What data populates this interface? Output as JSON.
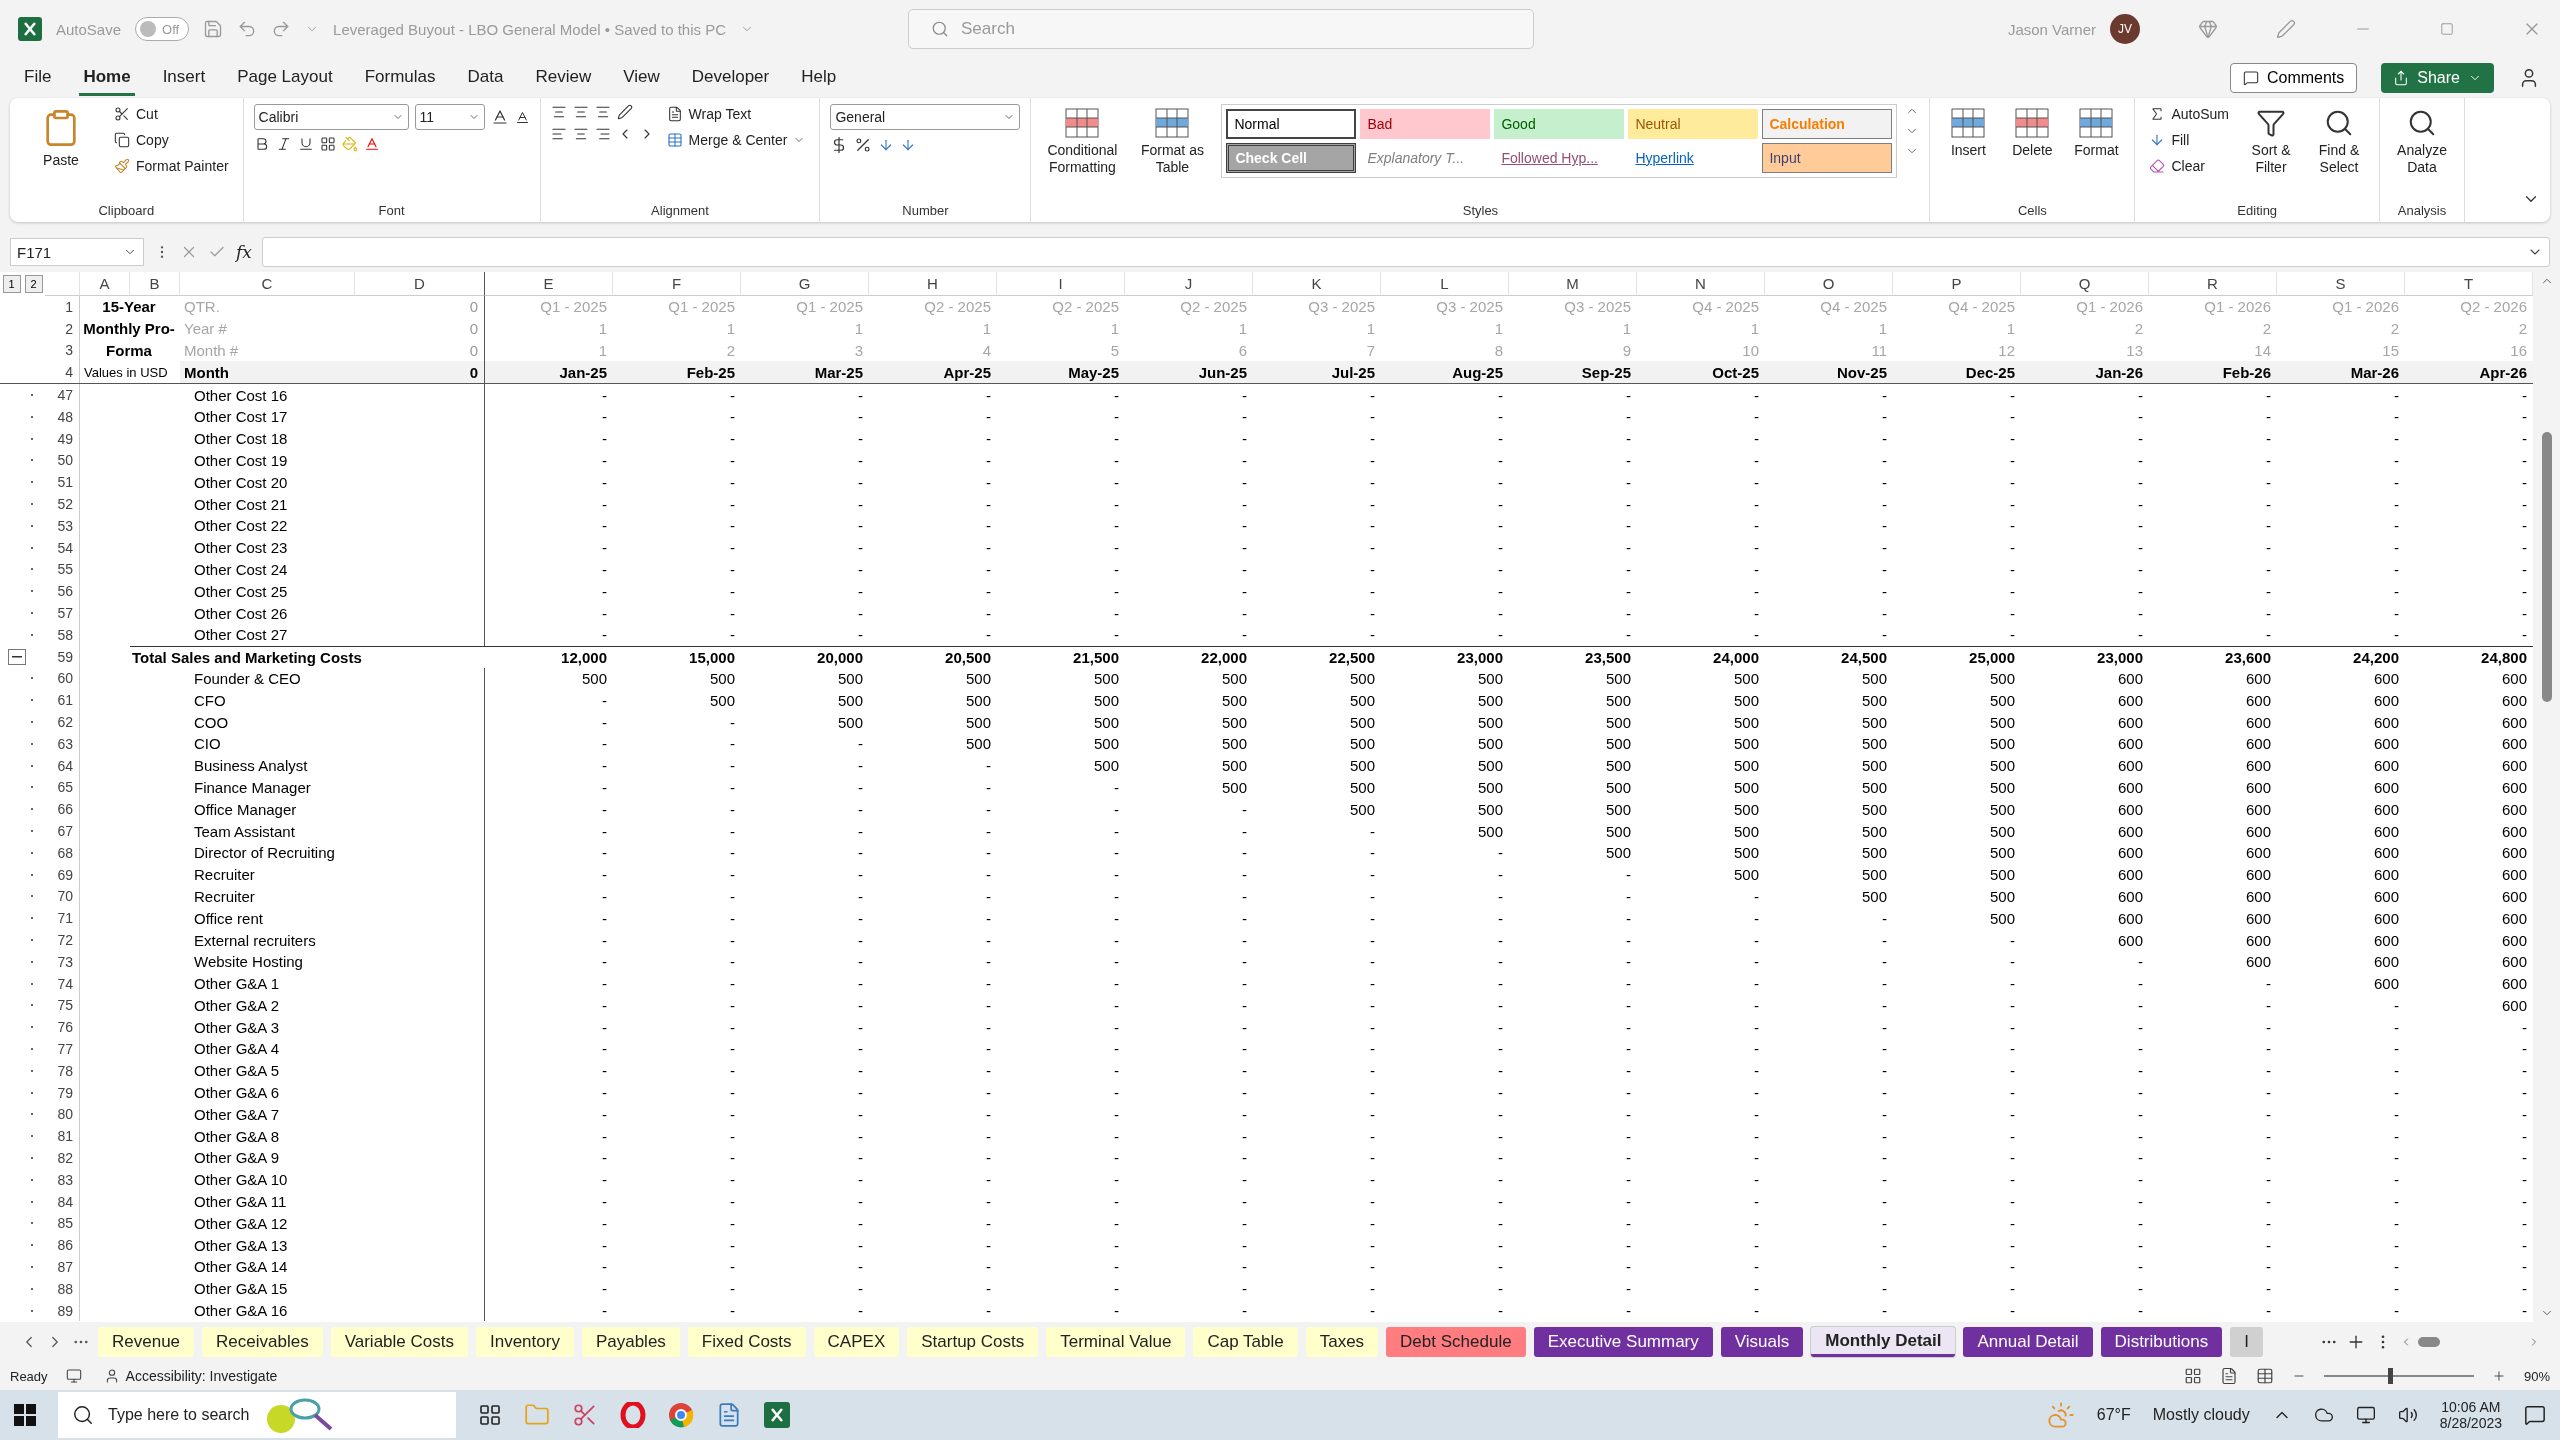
{
  "title_bar": {
    "autosave": {
      "label": "AutoSave",
      "state": "Off",
      "on": false
    },
    "document_title": "Leveraged Buyout - LBO General Model • Saved to this PC",
    "search": {
      "placeholder": "Search"
    },
    "user": {
      "name": "Jason Varner",
      "initials": "JV"
    }
  },
  "menu_tabs": [
    {
      "label": "File",
      "selected": false
    },
    {
      "label": "Home",
      "selected": true
    },
    {
      "label": "Insert",
      "selected": false
    },
    {
      "label": "Page Layout",
      "selected": false
    },
    {
      "label": "Formulas",
      "selected": false
    },
    {
      "label": "Data",
      "selected": false
    },
    {
      "label": "Review",
      "selected": false
    },
    {
      "label": "View",
      "selected": false
    },
    {
      "label": "Developer",
      "selected": false
    },
    {
      "label": "Help",
      "selected": false
    }
  ],
  "comments_button": "Comments",
  "share_button": "Share",
  "ribbon": {
    "clipboard": {
      "paste": "Paste",
      "cut": "Cut",
      "copy": "Copy",
      "format_painter": "Format Painter",
      "label": "Clipboard"
    },
    "font": {
      "name": "Calibri",
      "size": "11",
      "label": "Font"
    },
    "alignment": {
      "wrap_text": "Wrap Text",
      "merge_center": "Merge & Center",
      "label": "Alignment"
    },
    "number": {
      "format": "General",
      "label": "Number"
    },
    "styles": {
      "conditional": "Conditional Formatting",
      "format_table": "Format as Table",
      "label": "Styles",
      "cell_styles": [
        {
          "label": "Normal",
          "kind": "normal"
        },
        {
          "label": "Bad",
          "kind": "bad"
        },
        {
          "label": "Good",
          "kind": "good"
        },
        {
          "label": "Neutral",
          "kind": "neutral"
        },
        {
          "label": "Calculation",
          "kind": "calculation"
        },
        {
          "label": "Check Cell",
          "kind": "check"
        },
        {
          "label": "Explanatory T...",
          "kind": "explanatory"
        },
        {
          "label": "Followed Hyp...",
          "kind": "followed"
        },
        {
          "label": "Hyperlink",
          "kind": "hyperlink"
        },
        {
          "label": "Input",
          "kind": "input"
        }
      ]
    },
    "cells": {
      "insert": "Insert",
      "delete": "Delete",
      "format": "Format",
      "label": "Cells"
    },
    "editing": {
      "autosum": "AutoSum",
      "fill": "Fill",
      "clear": "Clear",
      "sort_filter": "Sort & Filter",
      "find_select": "Find & Select",
      "label": "Editing"
    },
    "analysis": {
      "analyze": "Analyze Data",
      "label": "Analysis"
    }
  },
  "formula_bar": {
    "name_box": "F171",
    "function_label": "fx"
  },
  "outline_levels": [
    "1",
    "2"
  ],
  "sheet": {
    "columns": [
      "A",
      "B",
      "C",
      "D",
      "E",
      "F",
      "G",
      "H",
      "I",
      "J",
      "K",
      "L",
      "M",
      "N",
      "O",
      "P",
      "Q",
      "R",
      "S",
      "T"
    ],
    "header_rows": [
      {
        "num": "1",
        "kind": "param",
        "title": "15-Year",
        "label": "QTR.",
        "d": "0",
        "values": [
          "Q1 - 2025",
          "Q1 - 2025",
          "Q1 - 2025",
          "Q2 - 2025",
          "Q2 - 2025",
          "Q2 - 2025",
          "Q3 - 2025",
          "Q3 - 2025",
          "Q3 - 2025",
          "Q4 - 2025",
          "Q4 - 2025",
          "Q4 - 2025",
          "Q1 - 2026",
          "Q1 - 2026",
          "Q1 - 2026",
          "Q2 - 2026"
        ]
      },
      {
        "num": "2",
        "kind": "param",
        "title": "Monthly Pro-",
        "label": "Year #",
        "d": "0",
        "values": [
          "1",
          "1",
          "1",
          "1",
          "1",
          "1",
          "1",
          "1",
          "1",
          "1",
          "1",
          "1",
          "2",
          "2",
          "2",
          "2"
        ]
      },
      {
        "num": "3",
        "kind": "param",
        "title": "Forma",
        "label": "Month #",
        "d": "0",
        "values": [
          "1",
          "2",
          "3",
          "4",
          "5",
          "6",
          "7",
          "8",
          "9",
          "10",
          "11",
          "12",
          "13",
          "14",
          "15",
          "16"
        ]
      },
      {
        "num": "4",
        "kind": "month",
        "title": "Values in USD",
        "label": "Month",
        "d": "0",
        "values": [
          "Jan-25",
          "Feb-25",
          "Mar-25",
          "Apr-25",
          "May-25",
          "Jun-25",
          "Jul-25",
          "Aug-25",
          "Sep-25",
          "Oct-25",
          "Nov-25",
          "Dec-25",
          "Jan-26",
          "Feb-26",
          "Mar-26",
          "Apr-26"
        ]
      }
    ],
    "rows": [
      {
        "num": "47",
        "kind": "item",
        "label": "Other Cost 16",
        "values": [
          "-",
          "-",
          "-",
          "-",
          "-",
          "-",
          "-",
          "-",
          "-",
          "-",
          "-",
          "-",
          "-",
          "-",
          "-",
          "-"
        ]
      },
      {
        "num": "48",
        "kind": "item",
        "label": "Other Cost 17",
        "values": [
          "-",
          "-",
          "-",
          "-",
          "-",
          "-",
          "-",
          "-",
          "-",
          "-",
          "-",
          "-",
          "-",
          "-",
          "-",
          "-"
        ]
      },
      {
        "num": "49",
        "kind": "item",
        "label": "Other Cost 18",
        "values": [
          "-",
          "-",
          "-",
          "-",
          "-",
          "-",
          "-",
          "-",
          "-",
          "-",
          "-",
          "-",
          "-",
          "-",
          "-",
          "-"
        ]
      },
      {
        "num": "50",
        "kind": "item",
        "label": "Other Cost 19",
        "values": [
          "-",
          "-",
          "-",
          "-",
          "-",
          "-",
          "-",
          "-",
          "-",
          "-",
          "-",
          "-",
          "-",
          "-",
          "-",
          "-"
        ]
      },
      {
        "num": "51",
        "kind": "item",
        "label": "Other Cost 20",
        "values": [
          "-",
          "-",
          "-",
          "-",
          "-",
          "-",
          "-",
          "-",
          "-",
          "-",
          "-",
          "-",
          "-",
          "-",
          "-",
          "-"
        ]
      },
      {
        "num": "52",
        "kind": "item",
        "label": "Other Cost 21",
        "values": [
          "-",
          "-",
          "-",
          "-",
          "-",
          "-",
          "-",
          "-",
          "-",
          "-",
          "-",
          "-",
          "-",
          "-",
          "-",
          "-"
        ]
      },
      {
        "num": "53",
        "kind": "item",
        "label": "Other Cost 22",
        "values": [
          "-",
          "-",
          "-",
          "-",
          "-",
          "-",
          "-",
          "-",
          "-",
          "-",
          "-",
          "-",
          "-",
          "-",
          "-",
          "-"
        ]
      },
      {
        "num": "54",
        "kind": "item",
        "label": "Other Cost 23",
        "values": [
          "-",
          "-",
          "-",
          "-",
          "-",
          "-",
          "-",
          "-",
          "-",
          "-",
          "-",
          "-",
          "-",
          "-",
          "-",
          "-"
        ]
      },
      {
        "num": "55",
        "kind": "item",
        "label": "Other Cost 24",
        "values": [
          "-",
          "-",
          "-",
          "-",
          "-",
          "-",
          "-",
          "-",
          "-",
          "-",
          "-",
          "-",
          "-",
          "-",
          "-",
          "-"
        ]
      },
      {
        "num": "56",
        "kind": "item",
        "label": "Other Cost 25",
        "values": [
          "-",
          "-",
          "-",
          "-",
          "-",
          "-",
          "-",
          "-",
          "-",
          "-",
          "-",
          "-",
          "-",
          "-",
          "-",
          "-"
        ]
      },
      {
        "num": "57",
        "kind": "item",
        "label": "Other Cost 26",
        "values": [
          "-",
          "-",
          "-",
          "-",
          "-",
          "-",
          "-",
          "-",
          "-",
          "-",
          "-",
          "-",
          "-",
          "-",
          "-",
          "-"
        ]
      },
      {
        "num": "58",
        "kind": "item",
        "label": "Other Cost 27",
        "values": [
          "-",
          "-",
          "-",
          "-",
          "-",
          "-",
          "-",
          "-",
          "-",
          "-",
          "-",
          "-",
          "-",
          "-",
          "-",
          "-"
        ]
      },
      {
        "num": "59",
        "kind": "total",
        "label": "Total Sales and Marketing Costs",
        "values": [
          "12,000",
          "15,000",
          "20,000",
          "20,500",
          "21,500",
          "22,000",
          "22,500",
          "23,000",
          "23,500",
          "24,000",
          "24,500",
          "25,000",
          "23,000",
          "23,600",
          "24,200",
          "24,800"
        ]
      },
      {
        "num": "60",
        "kind": "item",
        "label": "Founder & CEO",
        "values": [
          "500",
          "500",
          "500",
          "500",
          "500",
          "500",
          "500",
          "500",
          "500",
          "500",
          "500",
          "500",
          "600",
          "600",
          "600",
          "600"
        ]
      },
      {
        "num": "61",
        "kind": "item",
        "label": "CFO",
        "values": [
          "-",
          "500",
          "500",
          "500",
          "500",
          "500",
          "500",
          "500",
          "500",
          "500",
          "500",
          "500",
          "600",
          "600",
          "600",
          "600"
        ]
      },
      {
        "num": "62",
        "kind": "item",
        "label": "COO",
        "values": [
          "-",
          "-",
          "500",
          "500",
          "500",
          "500",
          "500",
          "500",
          "500",
          "500",
          "500",
          "500",
          "600",
          "600",
          "600",
          "600"
        ]
      },
      {
        "num": "63",
        "kind": "item",
        "label": "CIO",
        "values": [
          "-",
          "-",
          "-",
          "500",
          "500",
          "500",
          "500",
          "500",
          "500",
          "500",
          "500",
          "500",
          "600",
          "600",
          "600",
          "600"
        ]
      },
      {
        "num": "64",
        "kind": "item",
        "label": "Business Analyst",
        "values": [
          "-",
          "-",
          "-",
          "-",
          "500",
          "500",
          "500",
          "500",
          "500",
          "500",
          "500",
          "500",
          "600",
          "600",
          "600",
          "600"
        ]
      },
      {
        "num": "65",
        "kind": "item",
        "label": "Finance Manager",
        "values": [
          "-",
          "-",
          "-",
          "-",
          "-",
          "500",
          "500",
          "500",
          "500",
          "500",
          "500",
          "500",
          "600",
          "600",
          "600",
          "600"
        ]
      },
      {
        "num": "66",
        "kind": "item",
        "label": "Office Manager",
        "values": [
          "-",
          "-",
          "-",
          "-",
          "-",
          "-",
          "500",
          "500",
          "500",
          "500",
          "500",
          "500",
          "600",
          "600",
          "600",
          "600"
        ]
      },
      {
        "num": "67",
        "kind": "item",
        "label": "Team Assistant",
        "values": [
          "-",
          "-",
          "-",
          "-",
          "-",
          "-",
          "-",
          "500",
          "500",
          "500",
          "500",
          "500",
          "600",
          "600",
          "600",
          "600"
        ]
      },
      {
        "num": "68",
        "kind": "item",
        "label": "Director of Recruiting",
        "values": [
          "-",
          "-",
          "-",
          "-",
          "-",
          "-",
          "-",
          "-",
          "500",
          "500",
          "500",
          "500",
          "600",
          "600",
          "600",
          "600"
        ]
      },
      {
        "num": "69",
        "kind": "item",
        "label": "Recruiter",
        "values": [
          "-",
          "-",
          "-",
          "-",
          "-",
          "-",
          "-",
          "-",
          "-",
          "500",
          "500",
          "500",
          "600",
          "600",
          "600",
          "600"
        ]
      },
      {
        "num": "70",
        "kind": "item",
        "label": "Recruiter",
        "values": [
          "-",
          "-",
          "-",
          "-",
          "-",
          "-",
          "-",
          "-",
          "-",
          "-",
          "500",
          "500",
          "600",
          "600",
          "600",
          "600"
        ]
      },
      {
        "num": "71",
        "kind": "item",
        "label": "Office rent",
        "values": [
          "-",
          "-",
          "-",
          "-",
          "-",
          "-",
          "-",
          "-",
          "-",
          "-",
          "-",
          "500",
          "600",
          "600",
          "600",
          "600"
        ]
      },
      {
        "num": "72",
        "kind": "item",
        "label": "External recruiters",
        "values": [
          "-",
          "-",
          "-",
          "-",
          "-",
          "-",
          "-",
          "-",
          "-",
          "-",
          "-",
          "-",
          "600",
          "600",
          "600",
          "600"
        ]
      },
      {
        "num": "73",
        "kind": "item",
        "label": "Website Hosting",
        "values": [
          "-",
          "-",
          "-",
          "-",
          "-",
          "-",
          "-",
          "-",
          "-",
          "-",
          "-",
          "-",
          "-",
          "600",
          "600",
          "600"
        ]
      },
      {
        "num": "74",
        "kind": "item",
        "label": "Other G&A 1",
        "values": [
          "-",
          "-",
          "-",
          "-",
          "-",
          "-",
          "-",
          "-",
          "-",
          "-",
          "-",
          "-",
          "-",
          "-",
          "600",
          "600"
        ]
      },
      {
        "num": "75",
        "kind": "item",
        "label": "Other G&A 2",
        "values": [
          "-",
          "-",
          "-",
          "-",
          "-",
          "-",
          "-",
          "-",
          "-",
          "-",
          "-",
          "-",
          "-",
          "-",
          "-",
          "600"
        ]
      },
      {
        "num": "76",
        "kind": "item",
        "label": "Other G&A 3",
        "values": [
          "-",
          "-",
          "-",
          "-",
          "-",
          "-",
          "-",
          "-",
          "-",
          "-",
          "-",
          "-",
          "-",
          "-",
          "-",
          "-"
        ]
      },
      {
        "num": "77",
        "kind": "item",
        "label": "Other G&A 4",
        "values": [
          "-",
          "-",
          "-",
          "-",
          "-",
          "-",
          "-",
          "-",
          "-",
          "-",
          "-",
          "-",
          "-",
          "-",
          "-",
          "-"
        ]
      },
      {
        "num": "78",
        "kind": "item",
        "label": "Other G&A 5",
        "values": [
          "-",
          "-",
          "-",
          "-",
          "-",
          "-",
          "-",
          "-",
          "-",
          "-",
          "-",
          "-",
          "-",
          "-",
          "-",
          "-"
        ]
      },
      {
        "num": "79",
        "kind": "item",
        "label": "Other G&A 6",
        "values": [
          "-",
          "-",
          "-",
          "-",
          "-",
          "-",
          "-",
          "-",
          "-",
          "-",
          "-",
          "-",
          "-",
          "-",
          "-",
          "-"
        ]
      },
      {
        "num": "80",
        "kind": "item",
        "label": "Other G&A 7",
        "values": [
          "-",
          "-",
          "-",
          "-",
          "-",
          "-",
          "-",
          "-",
          "-",
          "-",
          "-",
          "-",
          "-",
          "-",
          "-",
          "-"
        ]
      },
      {
        "num": "81",
        "kind": "item",
        "label": "Other G&A 8",
        "values": [
          "-",
          "-",
          "-",
          "-",
          "-",
          "-",
          "-",
          "-",
          "-",
          "-",
          "-",
          "-",
          "-",
          "-",
          "-",
          "-"
        ]
      },
      {
        "num": "82",
        "kind": "item",
        "label": "Other G&A 9",
        "values": [
          "-",
          "-",
          "-",
          "-",
          "-",
          "-",
          "-",
          "-",
          "-",
          "-",
          "-",
          "-",
          "-",
          "-",
          "-",
          "-"
        ]
      },
      {
        "num": "83",
        "kind": "item",
        "label": "Other G&A 10",
        "values": [
          "-",
          "-",
          "-",
          "-",
          "-",
          "-",
          "-",
          "-",
          "-",
          "-",
          "-",
          "-",
          "-",
          "-",
          "-",
          "-"
        ]
      },
      {
        "num": "84",
        "kind": "item",
        "label": "Other G&A 11",
        "values": [
          "-",
          "-",
          "-",
          "-",
          "-",
          "-",
          "-",
          "-",
          "-",
          "-",
          "-",
          "-",
          "-",
          "-",
          "-",
          "-"
        ]
      },
      {
        "num": "85",
        "kind": "item",
        "label": "Other G&A 12",
        "values": [
          "-",
          "-",
          "-",
          "-",
          "-",
          "-",
          "-",
          "-",
          "-",
          "-",
          "-",
          "-",
          "-",
          "-",
          "-",
          "-"
        ]
      },
      {
        "num": "86",
        "kind": "item",
        "label": "Other G&A 13",
        "values": [
          "-",
          "-",
          "-",
          "-",
          "-",
          "-",
          "-",
          "-",
          "-",
          "-",
          "-",
          "-",
          "-",
          "-",
          "-",
          "-"
        ]
      },
      {
        "num": "87",
        "kind": "item",
        "label": "Other G&A 14",
        "values": [
          "-",
          "-",
          "-",
          "-",
          "-",
          "-",
          "-",
          "-",
          "-",
          "-",
          "-",
          "-",
          "-",
          "-",
          "-",
          "-"
        ]
      },
      {
        "num": "88",
        "kind": "item",
        "label": "Other G&A 15",
        "values": [
          "-",
          "-",
          "-",
          "-",
          "-",
          "-",
          "-",
          "-",
          "-",
          "-",
          "-",
          "-",
          "-",
          "-",
          "-",
          "-"
        ]
      },
      {
        "num": "89",
        "kind": "item",
        "label": "Other G&A 16",
        "values": [
          "-",
          "-",
          "-",
          "-",
          "-",
          "-",
          "-",
          "-",
          "-",
          "-",
          "-",
          "-",
          "-",
          "-",
          "-",
          "-"
        ]
      }
    ]
  },
  "sheet_tabs": [
    {
      "label": "Revenue",
      "color": "#ffffcc",
      "selected": false
    },
    {
      "label": "Receivables",
      "color": "#ffffcc",
      "selected": false
    },
    {
      "label": "Variable Costs",
      "color": "#ffffcc",
      "selected": false
    },
    {
      "label": "Inventory",
      "color": "#ffffcc",
      "selected": false
    },
    {
      "label": "Payables",
      "color": "#ffffcc",
      "selected": false
    },
    {
      "label": "Fixed Costs",
      "color": "#ffffcc",
      "selected": false
    },
    {
      "label": "CAPEX",
      "color": "#ffffcc",
      "selected": false
    },
    {
      "label": "Startup Costs",
      "color": "#ffffcc",
      "selected": false
    },
    {
      "label": "Terminal Value",
      "color": "#ffffcc",
      "selected": false
    },
    {
      "label": "Cap Table",
      "color": "#ffffcc",
      "selected": false
    },
    {
      "label": "Taxes",
      "color": "#ffffcc",
      "selected": false
    },
    {
      "label": "Debt Schedule",
      "color": "#ff7c80",
      "selected": false
    },
    {
      "label": "Executive Summary",
      "color": "#7030a0",
      "selected": false
    },
    {
      "label": "Visuals",
      "color": "#7030a0",
      "selected": false
    },
    {
      "label": "Monthly Detail",
      "color": "#7030a0",
      "selected": true
    },
    {
      "label": "Annual Detail",
      "color": "#7030a0",
      "selected": false
    },
    {
      "label": "Distributions",
      "color": "#7030a0",
      "selected": false
    },
    {
      "label": "I",
      "color": "#d0d0d0",
      "selected": false
    }
  ],
  "status_bar": {
    "ready": "Ready",
    "accessibility": "Accessibility: Investigate",
    "zoom": "90%",
    "level": 0.45
  },
  "taskbar": {
    "search_placeholder": "Type here to search",
    "temperature": "67°F",
    "weather": "Mostly cloudy",
    "time": "10:06 AM",
    "date": "8/28/2023"
  }
}
